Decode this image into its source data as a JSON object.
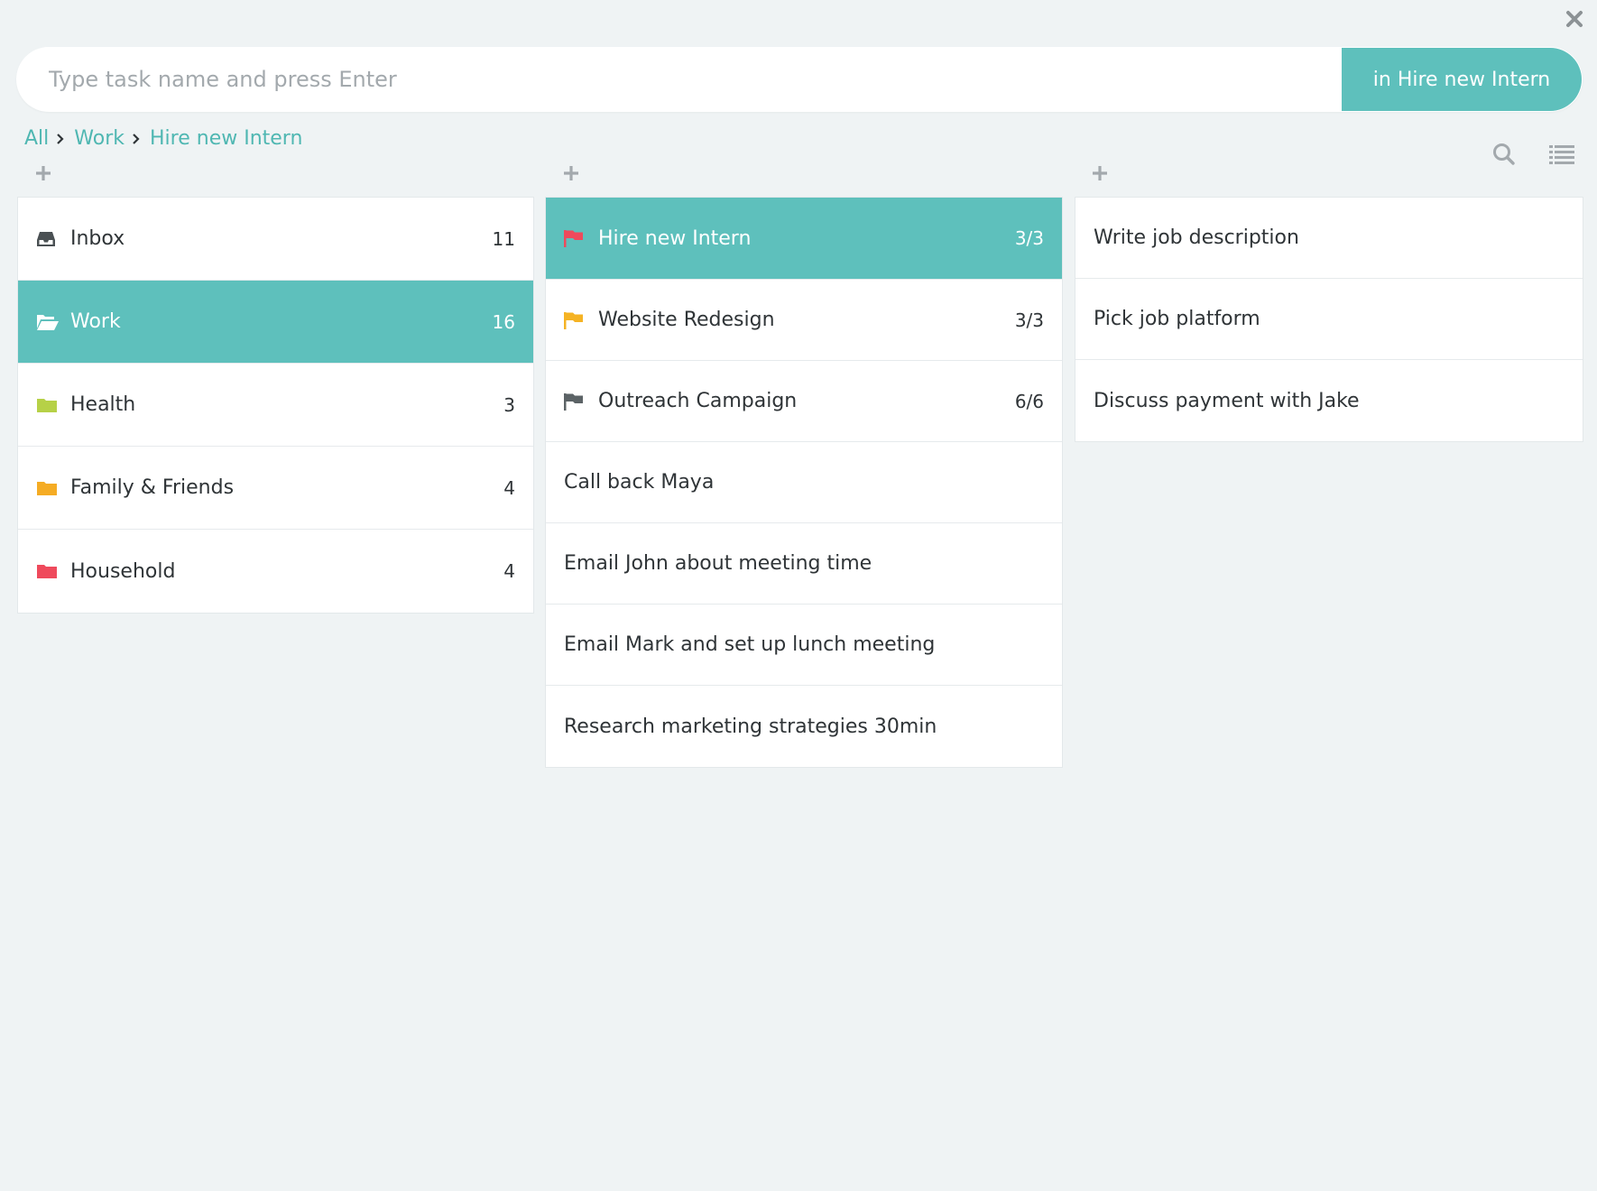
{
  "task_input": {
    "placeholder": "Type task name and press Enter",
    "target_button_label": "in Hire new Intern"
  },
  "breadcrumb": [
    {
      "label": "All"
    },
    {
      "label": "Work"
    },
    {
      "label": "Hire new Intern"
    }
  ],
  "toolbar": {
    "search_icon": "search-icon",
    "list_icon": "list-view-icon",
    "close_icon": "close-icon"
  },
  "colors": {
    "accent": "#5ec0bc",
    "link": "#4fb7b2",
    "background": "#eff3f4",
    "folder_health": "#b6d147",
    "folder_family": "#f5ac24",
    "folder_household": "#ef4a5c",
    "flag_red": "#ef4a5c",
    "flag_yellow": "#f5b324",
    "flag_gray": "#5c6366"
  },
  "lists": [
    {
      "label": "Inbox",
      "count": "11",
      "icon": "inbox-icon"
    },
    {
      "label": "Work",
      "count": "16",
      "icon": "open-folder-icon",
      "selected": true
    },
    {
      "label": "Health",
      "count": "3",
      "icon": "folder-icon"
    },
    {
      "label": "Family & Friends",
      "count": "4",
      "icon": "folder-icon"
    },
    {
      "label": "Household",
      "count": "4",
      "icon": "folder-icon"
    }
  ],
  "projects": [
    {
      "label": "Hire new Intern",
      "count": "3/3",
      "icon": "flag-icon",
      "selected": true
    },
    {
      "label": "Website Redesign",
      "count": "3/3",
      "icon": "flag-icon"
    },
    {
      "label": "Outreach Campaign",
      "count": "6/6",
      "icon": "flag-icon"
    },
    {
      "label": "Call back Maya"
    },
    {
      "label": "Email John about meeting time"
    },
    {
      "label": "Email Mark and set up lunch meeting"
    },
    {
      "label": "Research marketing strategies 30min"
    }
  ],
  "tasks": [
    {
      "label": "Write job description"
    },
    {
      "label": "Pick job platform"
    },
    {
      "label": "Discuss payment with Jake"
    }
  ]
}
